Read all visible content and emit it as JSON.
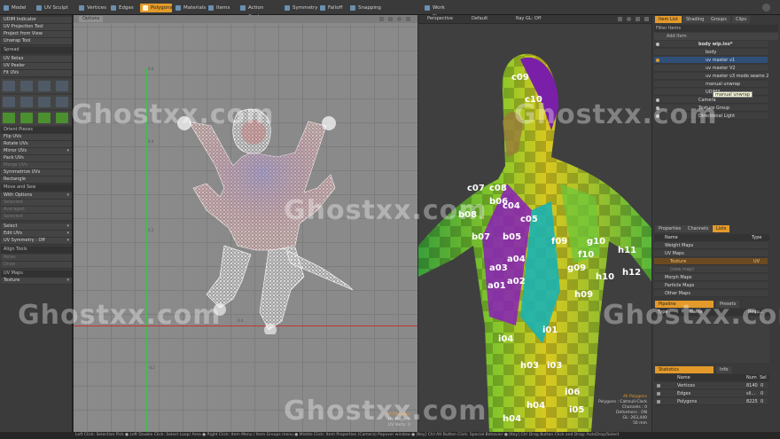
{
  "topbar": {
    "tabs": [
      {
        "label": "Model"
      },
      {
        "label": "UV Sculpt"
      },
      {
        "label": "Vertices"
      },
      {
        "label": "Edges"
      },
      {
        "label": "Polygons"
      },
      {
        "label": "Materials"
      },
      {
        "label": "Items"
      },
      {
        "label": "Action Center"
      },
      {
        "label": "Symmetry"
      },
      {
        "label": "Falloff"
      },
      {
        "label": "Snapping"
      },
      {
        "label": "Work Plane"
      }
    ],
    "active_tab": "Polygons"
  },
  "left_panel": {
    "tools": [
      "UDIM Indicator",
      "UV Projection Tool",
      "Project from View",
      "Unwrap Tool",
      "Spread",
      "UV Relax",
      "UV Peeler",
      "Fit UVs"
    ],
    "ops": [
      "Orient Pieces",
      "Flip UVs",
      "Rotate UVs",
      "Mirror UVs",
      "Pack UVs",
      "Merge UVs",
      "Symmetrize UVs",
      "Rectangle"
    ],
    "move_header": "Move and Sew",
    "move_rows": [
      "With Options",
      "Selected",
      "Averaged",
      "Selected"
    ],
    "select_rows": [
      "Select",
      "Edit UVs",
      "UV Symmetry : Off"
    ],
    "align_header": "Align Tools",
    "align_rows": [
      "Relax",
      "Draw"
    ],
    "uvmaps_header": "UV Maps",
    "uvmaps_value": "Texture"
  },
  "uv_viewport": {
    "options_label": "Options",
    "ticks": [
      "0.6",
      "0.4",
      "0.2",
      "-0.2",
      "0.4"
    ],
    "hud": [
      "All Polygons",
      "UV Polys: 0",
      "UV Verts: 0"
    ]
  },
  "perspective_viewport": {
    "view_label": "Perspective",
    "shading_label": "Default",
    "ray_label": "Ray GL: Off",
    "checker_labels": [
      "c09",
      "c10",
      "b08",
      "b07",
      "b06",
      "b05",
      "a04",
      "a03",
      "a01",
      "a02",
      "f09",
      "f10",
      "g09",
      "g10",
      "h09",
      "h10",
      "h11",
      "h12",
      "c07",
      "c08",
      "c04",
      "c05",
      "i01",
      "i04",
      "i03",
      "h03",
      "h04",
      "h04",
      "i06",
      "i05"
    ],
    "hud": [
      "All Polygons",
      "Polygons : Catmull-Clark",
      "Channels : 0",
      "Deformers : ON",
      "GL: 263,440",
      "50 mm"
    ]
  },
  "right_panel": {
    "top_tabs": [
      "Item List",
      "Shading",
      "Groups",
      "Clips"
    ],
    "filter_label": "Filter Items",
    "add_item_label": "Add Item",
    "items": [
      {
        "label": "body wip.lxo*",
        "bold": true
      },
      {
        "label": "body"
      },
      {
        "label": "uv master v1",
        "selected": true
      },
      {
        "label": "uv master V2"
      },
      {
        "label": "uv master v3 modo seams 2"
      },
      {
        "label": "manual unwrap"
      },
      {
        "label": "UDIM3"
      },
      {
        "label": "Camera"
      },
      {
        "label": "Texture Group"
      },
      {
        "label": "Directional Light"
      }
    ],
    "tooltip": "manual unwrap",
    "lists_tabs": [
      "Properties",
      "Channels",
      "Lists"
    ],
    "lists_columns": [
      "Name",
      "Type"
    ],
    "lists_rows": [
      {
        "label": "Weight Maps",
        "type": ""
      },
      {
        "label": "UV Maps",
        "type": ""
      },
      {
        "label": "Texture",
        "type": "UV",
        "selected": true
      },
      {
        "label": "(new map)",
        "type": ""
      },
      {
        "label": "Morph Maps",
        "type": ""
      },
      {
        "label": "Particle Maps",
        "type": ""
      },
      {
        "label": "Other Maps",
        "type": ""
      }
    ],
    "pipeline_tabs": [
      "Pipeline",
      "Presets"
    ],
    "pipeline_columns": [
      "Type",
      "Name",
      "Requ..."
    ],
    "stats_tabs": [
      "Statistics",
      "Info"
    ],
    "stats_columns": [
      "Name",
      "Num",
      "Sel"
    ],
    "stats_rows": [
      {
        "label": "Vertices",
        "num": "8140",
        "sel": "0"
      },
      {
        "label": "Edges",
        "num": "sli...",
        "sel": "0"
      },
      {
        "label": "Polygons",
        "num": "8225",
        "sel": "0"
      }
    ]
  },
  "statusbar": {
    "text": "Left Click: Selection Pick ● Left Double Click: Select Loop/ Area ● Right Click: Item Menu / Item Groups menu ● Middle Click: Item Properties (Camera) Popover window ● [Key] Ctrl Alt Button Click: Special Behavior ● [Key] Ctrl Drag Button Click and Drag: AutoDrop/Select"
  },
  "watermark": "Ghostxx.com",
  "colors": {
    "accent": "#e39a2a",
    "selection": "#2f4f78",
    "uv_bg": "#8a8a8a",
    "axis_green": "#39c44a",
    "axis_red": "#c43535"
  }
}
